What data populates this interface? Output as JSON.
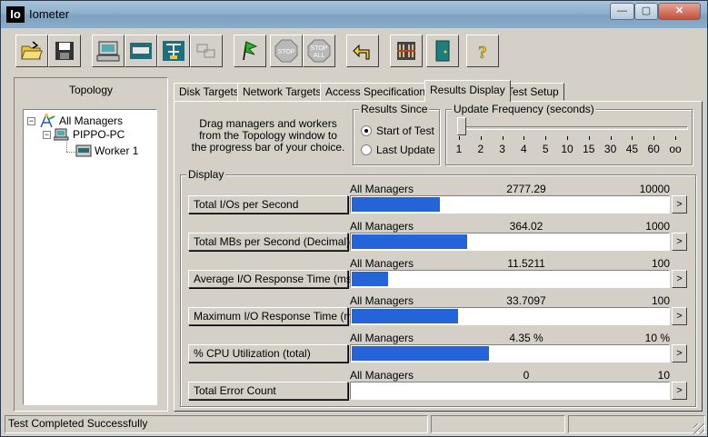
{
  "window": {
    "app_icon_text": "Io",
    "title": "Iometer",
    "min_glyph": "—",
    "max_glyph": "▢",
    "close_glyph": "✕"
  },
  "toolbar": {
    "buttons": [
      {
        "name": "open-config-button",
        "icon": "open-folder-icon"
      },
      {
        "name": "save-config-button",
        "icon": "save-disk-icon"
      },
      {
        "name": "new-disk-worker-button",
        "icon": "computer-icon"
      },
      {
        "name": "new-network-worker-button",
        "icon": "network-worker-icon"
      },
      {
        "name": "duplicate-worker-button",
        "icon": "network-switch-icon"
      },
      {
        "name": "disconnect-button",
        "icon": "disconnect-icon"
      },
      {
        "name": "start-tests-button",
        "icon": "green-flag-icon"
      },
      {
        "name": "stop-button",
        "icon": "stop-sign-icon",
        "label": "STOP"
      },
      {
        "name": "stop-all-button",
        "icon": "stop-all-sign-icon",
        "label": "STOP",
        "sublabel": "ALL"
      },
      {
        "name": "reset-workers-button",
        "icon": "reset-arrow-icon"
      },
      {
        "name": "exit-button",
        "icon": "door-icon"
      },
      {
        "name": "help-button",
        "icon": "question-mark-icon",
        "label": "?"
      }
    ]
  },
  "topology": {
    "title": "Topology",
    "nodes": [
      {
        "label": "All Managers",
        "icon": "all-managers-icon",
        "expander": "−"
      },
      {
        "label": "PIPPO-PC",
        "icon": "computer-icon",
        "expander": "−"
      },
      {
        "label": "Worker 1",
        "icon": "worker-icon"
      }
    ]
  },
  "tabs": [
    {
      "label": "Disk Targets",
      "active": false
    },
    {
      "label": "Network Targets",
      "active": false
    },
    {
      "label": "Access Specifications",
      "active": false
    },
    {
      "label": "Results Display",
      "active": true
    },
    {
      "label": "Test Setup",
      "active": false
    }
  ],
  "results_display": {
    "drag_note": "Drag managers and workers from the Topology window to the progress bar of your choice.",
    "results_since": {
      "label": "Results Since",
      "options": [
        {
          "label": "Start of Test",
          "checked": true
        },
        {
          "label": "Last Update",
          "checked": false
        }
      ]
    },
    "update_frequency": {
      "label": "Update Frequency (seconds)",
      "ticks": [
        "1",
        "2",
        "3",
        "4",
        "5",
        "10",
        "15",
        "30",
        "45",
        "60",
        "oo"
      ],
      "selected": "1"
    },
    "display": {
      "label": "Display",
      "arrow_glyph": ">",
      "rows": [
        {
          "button": "Total I/Os per Second",
          "source": "All Managers",
          "value": "2777.29",
          "max": "10000",
          "fraction": 0.278
        },
        {
          "button": "Total MBs per Second (Decimal)",
          "source": "All Managers",
          "value": "364.02",
          "max": "1000",
          "fraction": 0.364
        },
        {
          "button": "Average I/O Response Time (ms)",
          "source": "All Managers",
          "value": "11.5211",
          "max": "100",
          "fraction": 0.115
        },
        {
          "button": "Maximum I/O Response Time (ms)",
          "source": "All Managers",
          "value": "33.7097",
          "max": "100",
          "fraction": 0.337
        },
        {
          "button": "% CPU Utilization (total)",
          "source": "All Managers",
          "value": "4.35 %",
          "max": "10 %",
          "fraction": 0.435
        },
        {
          "button": "Total Error Count",
          "source": "All Managers",
          "value": "0",
          "max": "10",
          "fraction": 0
        }
      ]
    }
  },
  "status": {
    "message": "Test Completed Successfully"
  },
  "colors": {
    "progress_fill": "#2563d8",
    "face": "#d4d0c8",
    "titlebar": "#8fb0cc"
  }
}
